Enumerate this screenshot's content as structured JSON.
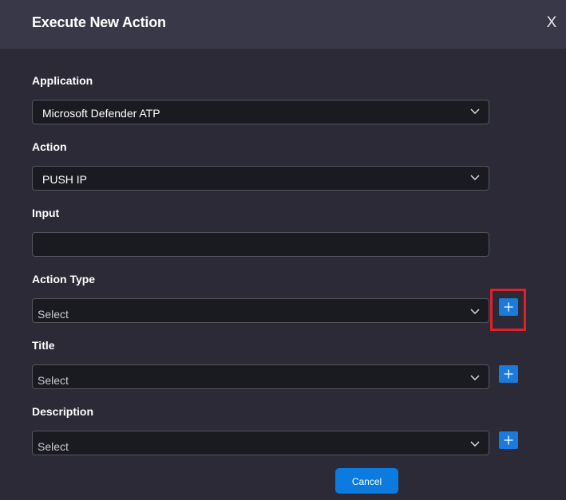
{
  "dialog": {
    "title": "Execute New Action",
    "close_label": "X"
  },
  "fields": {
    "application": {
      "label": "Application",
      "value": "Microsoft Defender ATP"
    },
    "action": {
      "label": "Action",
      "value": "PUSH IP"
    },
    "input": {
      "label": "Input",
      "value": ""
    },
    "action_type": {
      "label": "Action Type",
      "placeholder": "Select"
    },
    "title": {
      "label": "Title",
      "placeholder": "Select"
    },
    "description": {
      "label": "Description",
      "placeholder": "Select"
    }
  },
  "footer": {
    "cancel_label": "Cancel"
  },
  "icons": {
    "dropdown": "chevron-down-icon",
    "add": "plus-icon",
    "close": "close-icon"
  },
  "colors": {
    "accent": "#1a7bdc",
    "highlight": "#e3202a",
    "background": "#2b2a36",
    "header": "#393848"
  }
}
